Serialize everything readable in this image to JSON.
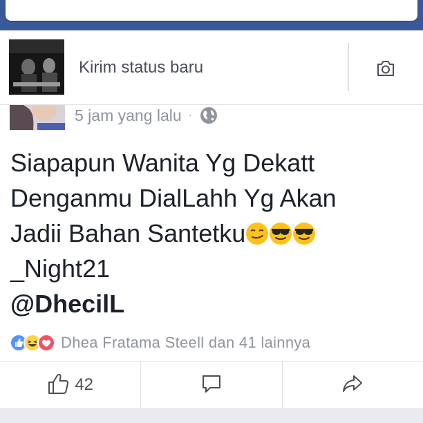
{
  "composer": {
    "prompt": "Kirim status baru",
    "camera_icon": "camera-icon"
  },
  "post": {
    "time": "5 jam yang lalu",
    "separator": "·",
    "privacy_icon": "globe-icon",
    "lines": [
      "Siapapun Wanita Yg Dekatt",
      "Denganmu DialLahh Yg Akan",
      "Jadii Bahan Santetku",
      "_Night21"
    ],
    "mention": "@DhecilL",
    "emojis": [
      "smirk-emoji",
      "sunglasses-emoji",
      "sunglasses-emoji"
    ]
  },
  "reactions": {
    "icons": [
      "like-icon",
      "haha-icon",
      "love-icon"
    ],
    "summary": "Dhea Fratama Steell dan 41 lainnya"
  },
  "actions": {
    "like_count": "42",
    "like_icon": "thumbs-up-icon",
    "comment_icon": "comment-icon",
    "share_icon": "share-icon"
  },
  "colors": {
    "brand": "#3b5998",
    "like_blue": "#5890ff",
    "love_red": "#f25268",
    "haha_yellow": "#fcd34d",
    "secondary_text": "#90949c"
  }
}
